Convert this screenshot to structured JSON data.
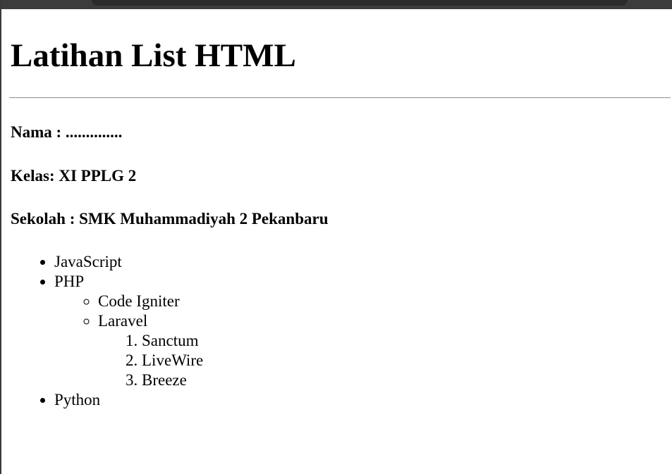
{
  "page": {
    "title": "Latihan List HTML",
    "nama": "Nama : ..............",
    "kelas": "Kelas: XI PPLG 2",
    "sekolah": "Sekolah : SMK Muhammadiyah 2 Pekanbaru"
  },
  "list": {
    "items": [
      {
        "label": "JavaScript"
      },
      {
        "label": "PHP"
      },
      {
        "label": "Python"
      }
    ],
    "php_sub": [
      {
        "label": "Code Igniter"
      },
      {
        "label": "Laravel"
      }
    ],
    "laravel_sub": [
      {
        "label": "Sanctum"
      },
      {
        "label": "LiveWire"
      },
      {
        "label": "Breeze"
      }
    ]
  }
}
